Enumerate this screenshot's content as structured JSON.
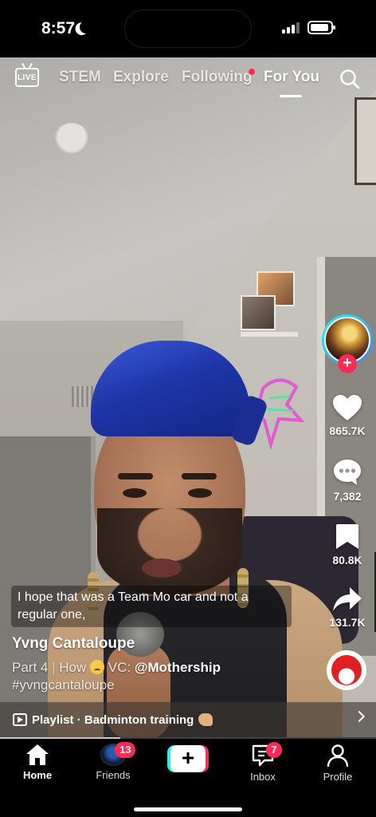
{
  "status_bar": {
    "time": "8:57"
  },
  "top_nav": {
    "live_label": "LIVE",
    "tabs": [
      {
        "label": "STEM"
      },
      {
        "label": "Explore"
      },
      {
        "label": "Following"
      },
      {
        "label": "For You"
      }
    ],
    "active_tab": "For You"
  },
  "actions": {
    "likes": "865.7K",
    "comments": "7,382",
    "saves": "80.8K",
    "shares": "131.7K"
  },
  "video": {
    "subtitle": "I hope that was a Team Mo car and not a regular one,",
    "creator": "Yvng Cantaloupe",
    "caption_part": "Part 4",
    "caption_sep": "|",
    "caption_how": "How",
    "caption_vc": "VC:",
    "mention": "@Mothership",
    "hashtag": "#yvngcantaloupe",
    "playlist": "Playlist · Badminton training",
    "progress": 0.32
  },
  "bottom_nav": {
    "items": [
      {
        "label": "Home"
      },
      {
        "label": "Friends",
        "badge": "13"
      },
      {
        "label": "Create"
      },
      {
        "label": "Inbox",
        "badge": "7"
      },
      {
        "label": "Profile"
      }
    ]
  },
  "colors": {
    "accent": "#fe2c55",
    "cyan": "#25f4ee",
    "bar": "#000000"
  }
}
